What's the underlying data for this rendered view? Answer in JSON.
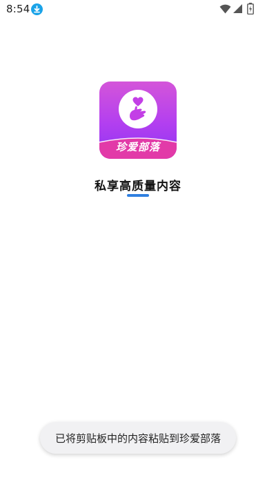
{
  "status_bar": {
    "time": "8:54",
    "icons": [
      "download-icon",
      "wifi-icon",
      "signal-icon",
      "battery-icon"
    ]
  },
  "app": {
    "logo_text": "珍爱部落",
    "tagline": "私享高质量内容",
    "colors": {
      "gradient_top": "#d455d9",
      "gradient_bottom": "#8f35f2",
      "banner": "#e23aa8",
      "accent_underline": "#2f7fe0"
    }
  },
  "toast": {
    "message": "已将剪贴板中的内容粘贴到珍爱部落"
  }
}
